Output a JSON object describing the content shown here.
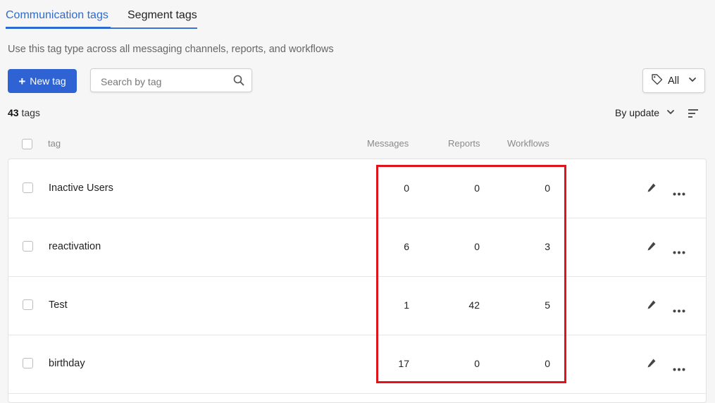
{
  "tabs": [
    {
      "label": "Communication tags",
      "active": true
    },
    {
      "label": "Segment tags",
      "active": false
    }
  ],
  "description": "Use this tag type across all messaging channels, reports, and workflows",
  "toolbar": {
    "new_tag_label": "New tag",
    "search_placeholder": "Search by tag",
    "filter_label": "All"
  },
  "summary": {
    "count": "43",
    "unit": "tags"
  },
  "sort": {
    "label": "By update"
  },
  "columns": {
    "tag": "tag",
    "messages": "Messages",
    "reports": "Reports",
    "workflows": "Workflows"
  },
  "rows": [
    {
      "name": "Inactive Users",
      "messages": "0",
      "reports": "0",
      "workflows": "0"
    },
    {
      "name": "reactivation",
      "messages": "6",
      "reports": "0",
      "workflows": "3"
    },
    {
      "name": "Test",
      "messages": "1",
      "reports": "42",
      "workflows": "5"
    },
    {
      "name": "birthday",
      "messages": "17",
      "reports": "0",
      "workflows": "0"
    }
  ],
  "colors": {
    "accent": "#2f63d3",
    "highlight": "#e0131b"
  },
  "icons": [
    "plus-icon",
    "search-icon",
    "tag-icon",
    "chevron-down-icon",
    "sort-icon",
    "pencil-icon",
    "more-icon"
  ]
}
